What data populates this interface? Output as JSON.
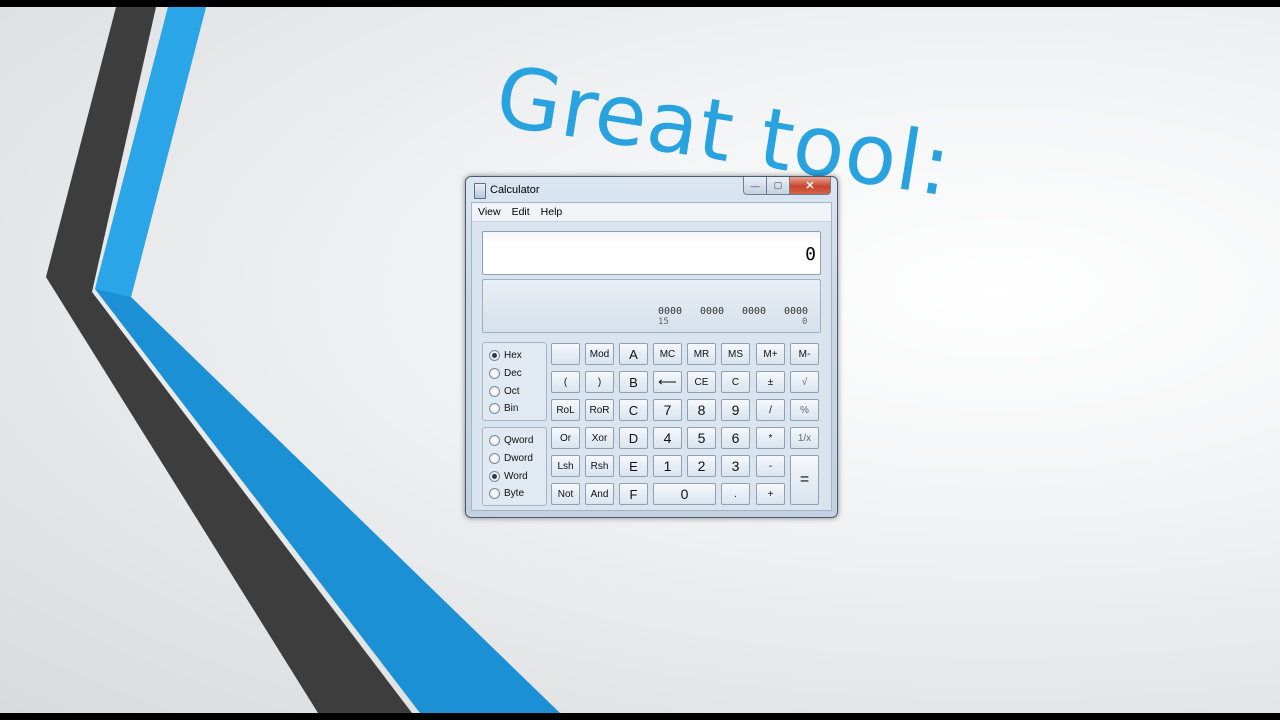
{
  "slide": {
    "headline": "Great tool:"
  },
  "window": {
    "title": "Calculator",
    "caption": {
      "minimize": "—",
      "maximize": "▢",
      "close": "✕"
    }
  },
  "menu": [
    "View",
    "Edit",
    "Help"
  ],
  "display": {
    "value": "0"
  },
  "bits": {
    "groups": [
      "0000",
      "0000",
      "0000",
      "0000"
    ],
    "left_index": "15",
    "right_index": "0"
  },
  "radix": {
    "options": [
      "Hex",
      "Dec",
      "Oct",
      "Bin"
    ],
    "selected": "Hex"
  },
  "wordsize": {
    "options": [
      "Qword",
      "Dword",
      "Word",
      "Byte"
    ],
    "selected": "Word"
  },
  "keys": {
    "row1": [
      "",
      "Mod",
      "A",
      "MC",
      "MR",
      "MS",
      "M+",
      "M-"
    ],
    "row2": [
      "(",
      ")",
      "B",
      "⟵",
      "CE",
      "C",
      "±",
      "√"
    ],
    "row3": [
      "RoL",
      "RoR",
      "C",
      "7",
      "8",
      "9",
      "/",
      "%"
    ],
    "row4": [
      "Or",
      "Xor",
      "D",
      "4",
      "5",
      "6",
      "*",
      "1/x"
    ],
    "row5": [
      "Lsh",
      "Rsh",
      "E",
      "1",
      "2",
      "3",
      "-"
    ],
    "row6": [
      "Not",
      "And",
      "F",
      "0",
      ".",
      "+"
    ],
    "equals": "="
  }
}
